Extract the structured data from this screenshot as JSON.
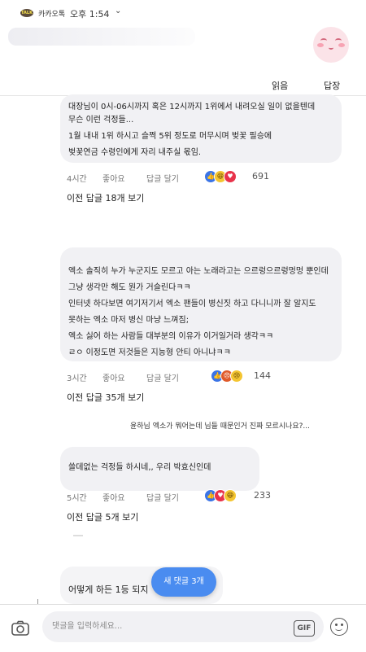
{
  "status": {
    "app_name": "카카오톡",
    "talk_badge": "TALK",
    "time": "오후 1:54"
  },
  "header": {
    "tabs": [
      "읽음",
      "답장"
    ]
  },
  "comments": [
    {
      "lines": [
        "대장님이 0시-06시까지 혹은 12시까지 1위에서 내려오실 일이 없을텐데",
        "무슨 이런 걱정들...",
        "1월 내내 1위 하시고 슬쩍 5위 정도로 머무시며 벚꽃 필승에",
        "벚꽃연금 수령인에게 자리 내주실 몫임."
      ],
      "time": "4시간",
      "like_label": "좋아요",
      "reply_label": "답글 달기",
      "reaction_count": "691",
      "more_replies": "이전 답글 18개 보기"
    },
    {
      "lines": [
        "엑소 솔직히 누가 누군지도 모르고 아는 노래라고는 으르렁으르렁멍멍 뿐인데",
        "그냥 생각만 해도 뭔가 거슬린다ㅋㅋ",
        "인터넷 하다보면 여기저기서 엑소 팬들이 병신짓 하고 다니니까 잘 알지도",
        "못하는 엑소 마저 병신 마냥 느껴짐;",
        "엑소 싫어 하는 사람들 대부분의 이유가 이거일거라 생각ㅋㅋ",
        "ㄹㅇ 이정도면 저것들은 지능형 안티 아니냐ㅋㅋ"
      ],
      "time": "3시간",
      "like_label": "좋아요",
      "reply_label": "답글 달기",
      "reaction_count": "144",
      "more_replies": "이전 답글 35개 보기"
    },
    {
      "lines": [
        "쓸데없는 걱정들 하시네,, 우리 박효신인데"
      ],
      "time": "5시간",
      "like_label": "좋아요",
      "reply_label": "답글 달기",
      "reaction_count": "233",
      "more_replies": "이전 답글 5개 보기"
    }
  ],
  "note": "윤하님 엑소가 뭐어는데 님들 때문인거 진짜 모르시나요?...",
  "partial_comment": "어떻게 하든 1등 되지",
  "fab_label": "새 댓글 3개",
  "composer": {
    "placeholder": "댓글을 입력하세요...",
    "gif_label": "GIF"
  },
  "colors": {
    "accent": "#4a8cf0",
    "bubble": "#f1f1f4"
  }
}
